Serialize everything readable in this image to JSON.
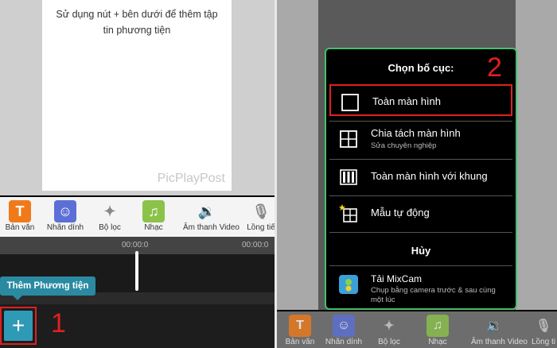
{
  "left": {
    "canvas_message": "Sử dụng nút + bên dưới để thêm tập tin phương tiện",
    "watermark": "PicPlayPost",
    "tools": [
      {
        "label": "Bản văn",
        "icon": "text-icon",
        "color": "#f07a1a",
        "glyph": "T"
      },
      {
        "label": "Nhãn dính",
        "icon": "sticker-icon",
        "color": "#5b6fd6",
        "glyph": "☺"
      },
      {
        "label": "Bộ lọc",
        "icon": "magic-wand-icon",
        "color": "#f4f4f4",
        "glyph": "✦"
      },
      {
        "label": "Nhạc",
        "icon": "music-icon",
        "color": "#8bc34a",
        "glyph": "♫"
      },
      {
        "label": "Âm thanh Video",
        "icon": "speaker-icon",
        "color": "#f4f4f4",
        "glyph": "🔉"
      },
      {
        "label": "Lồng tiế",
        "icon": "microphone-icon",
        "color": "#f4f4f4",
        "glyph": "🎙"
      }
    ],
    "timecode_center": "00:00:0",
    "timecode_right": "00:00:0",
    "tooltip": "Thêm Phương tiện",
    "add_glyph": "+",
    "step_number": "1"
  },
  "right": {
    "dialog_title": "Chọn bố cục:",
    "step_number": "2",
    "options": [
      {
        "label": "Toàn màn hình",
        "sub": "",
        "icon": "fullscreen-layout-icon"
      },
      {
        "label": "Chia tách màn hình",
        "sub": "Sửa chuyên nghiệp",
        "icon": "split-screen-icon"
      },
      {
        "label": "Toàn màn hình với khung",
        "sub": "",
        "icon": "framed-fullscreen-icon"
      },
      {
        "label": "Mẫu tự động",
        "sub": "",
        "icon": "auto-template-icon"
      }
    ],
    "cancel_label": "Hủy",
    "promo_title": "Tải MixCam",
    "promo_sub_line1": "Chụp bằng camera trước & sau cùng",
    "promo_sub_line2": "một lúc",
    "tools": [
      {
        "label": "Bản văn",
        "color": "#f07a1a",
        "glyph": "T"
      },
      {
        "label": "Nhãn dính",
        "color": "#5b6fd6",
        "glyph": "☺"
      },
      {
        "label": "Bộ lọc",
        "color": "#6d6d6d",
        "glyph": "✦"
      },
      {
        "label": "Nhạc",
        "color": "#8bc34a",
        "glyph": "♫"
      },
      {
        "label": "Âm thanh Video",
        "color": "#6d6d6d",
        "glyph": "🔉"
      },
      {
        "label": "Lồng ti",
        "color": "#6d6d6d",
        "glyph": "🎙"
      }
    ]
  },
  "colors": {
    "accent": "#2f9ab6",
    "highlight": "#e02020",
    "dialog_border": "#43c06a"
  }
}
